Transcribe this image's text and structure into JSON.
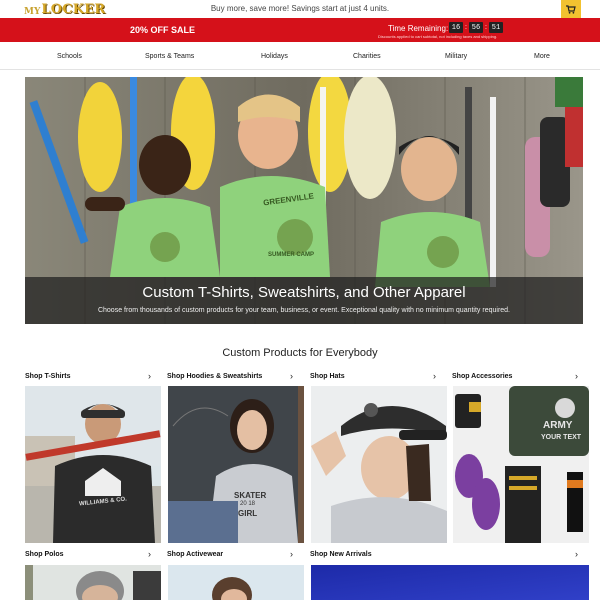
{
  "header": {
    "logo_prefix": "MY",
    "logo_main": "LOCKER",
    "promo": "Buy more, save more! Savings start at just 4 units.",
    "cart_icon": "cart-icon"
  },
  "sale_bar": {
    "title": "20% OFF SALE",
    "timer_label": "Time Remaining:",
    "hours": "16",
    "minutes": "56",
    "seconds": "51",
    "note": "Discounts applied to cart subtotal, not including taxes and shipping."
  },
  "nav": {
    "items": [
      "Schools",
      "Sports & Teams",
      "Holidays",
      "Charities",
      "Military",
      "More"
    ]
  },
  "hero": {
    "title": "Custom T-Shirts, Sweatshirts, and Other Apparel",
    "subtitle": "Choose from thousands of custom products for your team, business, or event. Exceptional quality with no minimum quantity required.",
    "shirt_text_top": "GREENVILLE",
    "shirt_text_bottom": "SUMMER CAMP"
  },
  "section": {
    "title": "Custom Products for Everybody",
    "categories": [
      "Shop T-Shirts",
      "Shop Hoodies & Sweatshirts",
      "Shop Hats",
      "Shop Accessories",
      "Shop Polos",
      "Shop Activewear",
      "Shop New Arrivals"
    ],
    "tile_text": {
      "tshirt_logo": "WILLIAMS & CO.",
      "hoodie_line1": "SKATER",
      "hoodie_line2": "20 18",
      "hoodie_line3": "GIRL",
      "army_line1": "ARMY",
      "army_line2": "YOUR TEXT"
    }
  },
  "colors": {
    "sale_red": "#d5111a",
    "cart_yellow": "#f2c230",
    "shirt_green": "#8fd27c"
  }
}
